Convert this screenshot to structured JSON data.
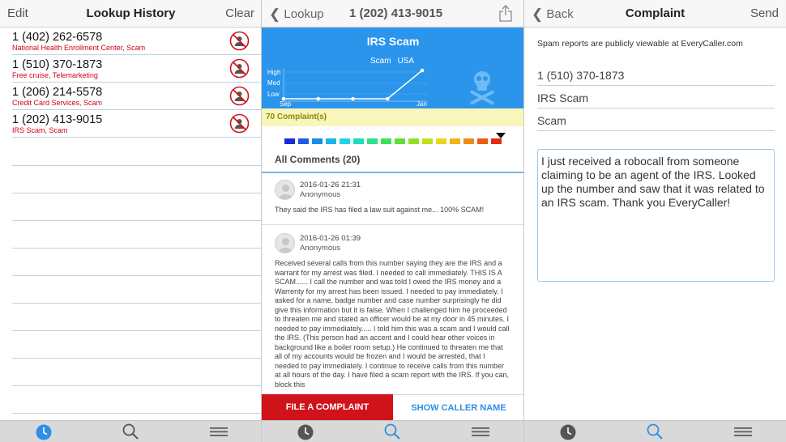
{
  "history": {
    "nav": {
      "left": "Edit",
      "title": "Lookup History",
      "right": "Clear"
    },
    "rows": [
      {
        "number": "1 (402) 262-6578",
        "desc": "National Health Enrollment Center, Scam"
      },
      {
        "number": "1 (510) 370-1873",
        "desc": "Free cruise, Telemarketing"
      },
      {
        "number": "1 (206) 214-5578",
        "desc": "Credit Card Services, Scam"
      },
      {
        "number": "1 (202) 413-9015",
        "desc": "IRS Scam, Scam"
      }
    ],
    "tabs": [
      "history-icon",
      "search-icon",
      "menu-icon"
    ],
    "active_tab": 0
  },
  "lookup": {
    "nav": {
      "back": "Lookup",
      "number": "1 (202) 413-9015"
    },
    "chart_title": "IRS Scam",
    "legend": [
      "Scam",
      "USA"
    ],
    "chart_data": {
      "type": "line",
      "x_ticks": [
        "Sep",
        "Jan"
      ],
      "y_categories": [
        "Low",
        "Med",
        "High"
      ],
      "values": [
        1,
        1,
        1,
        1,
        3
      ],
      "color": "#ffffff"
    },
    "complaints": "70 Complaint(s)",
    "heat_colors": [
      "#1a2ad8",
      "#1f5be0",
      "#1a8be6",
      "#19b4ea",
      "#20d4e6",
      "#20ddb8",
      "#2ee08a",
      "#3ce05a",
      "#5ee035",
      "#92e02a",
      "#c2e020",
      "#e6d81c",
      "#f0b418",
      "#f08a16",
      "#ec5a14",
      "#e62a12"
    ],
    "comments_head": "All Comments (20)",
    "comments": [
      {
        "date": "2016-01-26 21:31",
        "author": "Anonymous",
        "body": "They said the IRS has filed a law suit against me... 100% SCAM!"
      },
      {
        "date": "2016-01-26 01:39",
        "author": "Anonymous",
        "body": "Received several calls from this number saying they are the IRS and a warrant for my arrest was filed.  I needed to call immediately.  THIS IS A SCAM......  I call the number and was told I owed the IRS money and a Warrenty for my arrest has been issued.  I needed to pay immediately.  I asked for a name, badge number and case number surprisingly he did give this information but it is false.  When I challenged him he proceeded to threaten me and stated an officer would be at my door in 45 minutes.  I needed to pay immediately..... I told him this was a scam and I would call the IRS. (This person had an accent and I could hear other voices in background like a boiler room setup.) He continued to threaten me that all of my accounts would be frozen and I would be arrested, that I needed to pay immediately.  I continue to receive calls from this number at all hours of the day. I have filed a scam report with the IRS.  If you can, block this"
      }
    ],
    "file_btn": "FILE A COMPLAINT",
    "show_btn": "SHOW CALLER NAME",
    "tabs": [
      "history-icon",
      "search-icon",
      "menu-icon"
    ],
    "active_tab": 1
  },
  "complaint": {
    "nav": {
      "back": "Back",
      "title": "Complaint",
      "right": "Send"
    },
    "note": "Spam reports are publicly viewable at EveryCaller.com",
    "number": "1 (510) 370-1873",
    "name": "IRS Scam",
    "category": "Scam",
    "text": "I just received a robocall from someone claiming to be an agent of the IRS. Looked up the number and saw that it was related to an IRS scam. Thank you EveryCaller!",
    "tabs": [
      "history-icon",
      "search-icon",
      "menu-icon"
    ],
    "active_tab": 1
  },
  "colors": {
    "accent": "#2b95ec",
    "danger": "#d0131b",
    "tab_active": "#2f8fe6",
    "tab_inactive": "#555555"
  }
}
